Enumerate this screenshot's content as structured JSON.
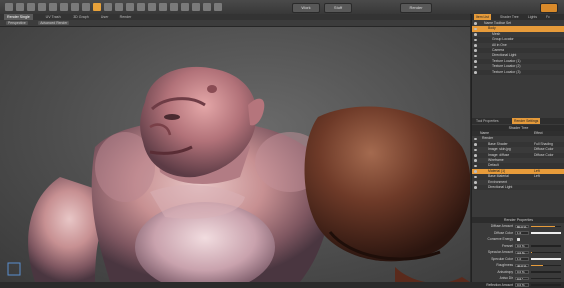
{
  "toolbar": {
    "tool_icons": [
      "select-icon",
      "move-icon",
      "rotate-icon",
      "scale-icon",
      "transform-icon",
      "element-move-icon",
      "sphere-icon",
      "cube-icon",
      "cylinder-icon",
      "pen-icon",
      "bevel-icon",
      "extrude-icon",
      "paint-icon",
      "falloff-icon",
      "symmetry-icon",
      "snap-icon",
      "action-center-icon",
      "work-plane-icon",
      "render-icon",
      "preview-icon"
    ],
    "btn_left": "Work",
    "btn_mid": "Stuff",
    "btn_right": "Render"
  },
  "viewport": {
    "tabs": [
      "Render Single",
      "UV Trash",
      "3D Graph",
      "User",
      "Render"
    ],
    "active_tab": 0,
    "view_buttons": [
      "Perspective",
      "Advanced Render"
    ]
  },
  "panel": {
    "top_tabs": [
      "Item List",
      "Shader Tree",
      "Lights",
      "Fc"
    ],
    "items": [
      {
        "label": "Name Toolbar Set",
        "indent": 1,
        "selected": false
      },
      {
        "label": "Body",
        "indent": 2,
        "selected": true
      },
      {
        "label": "Mesh",
        "indent": 3,
        "selected": false
      },
      {
        "label": "Group Locator",
        "indent": 3,
        "selected": false
      },
      {
        "label": "All in One",
        "indent": 3,
        "selected": false
      },
      {
        "label": "Camera",
        "indent": 3,
        "selected": false
      },
      {
        "label": "Directional Light",
        "indent": 3,
        "selected": false
      },
      {
        "label": "Texture Locator (1)",
        "indent": 3,
        "selected": false
      },
      {
        "label": "Texture Locator (2)",
        "indent": 3,
        "selected": false
      },
      {
        "label": "Texture Locator (3)",
        "indent": 3,
        "selected": false
      }
    ],
    "mid_tabs": [
      "Tool Properties",
      "Render Settings"
    ],
    "shader_header": "Shader Tree",
    "shader_cols": [
      "Name",
      "Effect"
    ],
    "shader_items": [
      {
        "label": "Render",
        "effect": "",
        "selected": false
      },
      {
        "label": "Base Shader",
        "effect": "Full Shading",
        "selected": false
      },
      {
        "label": "Image: skin.jpg",
        "effect": "Diffuse Color",
        "selected": false
      },
      {
        "label": "Image: diffuse",
        "effect": "Diffuse Color",
        "selected": false
      },
      {
        "label": "Wireframe",
        "effect": "",
        "selected": false
      },
      {
        "label": "Default",
        "effect": "",
        "selected": false
      },
      {
        "label": "Material (1)",
        "effect": "Left",
        "selected": true
      },
      {
        "label": "Base Material",
        "effect": "Left",
        "selected": false
      },
      {
        "label": "Environment",
        "effect": "",
        "selected": false
      },
      {
        "label": "Directional Light",
        "effect": "",
        "selected": false
      }
    ],
    "props_header": "Render Properties",
    "props": [
      {
        "label": "Diffuse Amount",
        "value": "80.0 %",
        "fill": 0.8,
        "type": "slider"
      },
      {
        "label": "Diffuse Color",
        "value": "1.0",
        "fill": 1.0,
        "type": "color"
      },
      {
        "label": "Conserve Energy",
        "value": "",
        "fill": 0,
        "type": "check"
      },
      {
        "label": "Fresnel",
        "value": "0.0 %",
        "fill": 0.0,
        "type": "slider"
      },
      {
        "label": "Specular Amount",
        "value": "4.0 %",
        "fill": 0.04,
        "type": "slider"
      },
      {
        "label": "Specular Color",
        "value": "1.0",
        "fill": 1.0,
        "type": "color"
      },
      {
        "label": "Roughness",
        "value": "40.0 %",
        "fill": 0.4,
        "type": "slider"
      },
      {
        "label": "Anisotropy",
        "value": "0.0 %",
        "fill": 0.0,
        "type": "slider"
      },
      {
        "label": "Aniso Dir",
        "value": "0.0 °",
        "fill": 0.0,
        "type": "slider"
      },
      {
        "label": "Reflection Amount",
        "value": "0.0 %",
        "fill": 0.0,
        "type": "slider"
      }
    ]
  },
  "colors": {
    "accent": "#e79b3a",
    "panel_bg": "#3a3a3a",
    "viewport_bg": "#555555"
  }
}
